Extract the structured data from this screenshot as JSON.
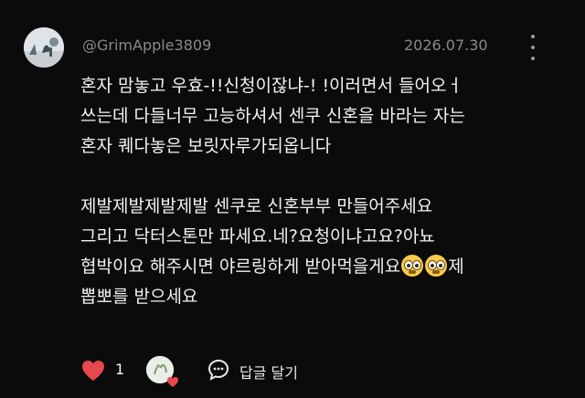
{
  "comment": {
    "username": "@GrimApple3809",
    "date": "2026.07.30",
    "paragraphs": [
      [
        "혼자 맘놓고 우효-!!신청이잖냐-! !이러면서 들어오ㅓ",
        "쓰는데 다들너무 고능하셔서 센쿠 신혼을 바라는 자는",
        "혼자 퀘다놓은 보릿자루가되옵니다"
      ],
      [
        "제발제발제발제발 센쿠로 신혼부부 만들어주세요",
        "그리고 닥터스톤만 파세요.네?요청이냐고요?아뇨",
        "협박이요 해주시면 야르링하게 받아먹을게요",
        "제",
        "뽑뽀를 받으세요"
      ]
    ],
    "emoji_name": "flushed-face-emoji"
  },
  "actions": {
    "like_count": "1",
    "reply_label": "답글 달기"
  },
  "colors": {
    "background": "#0b0b0b",
    "text": "#f2f2f2",
    "muted": "#8a8a8a",
    "heart": "#e5484d"
  }
}
